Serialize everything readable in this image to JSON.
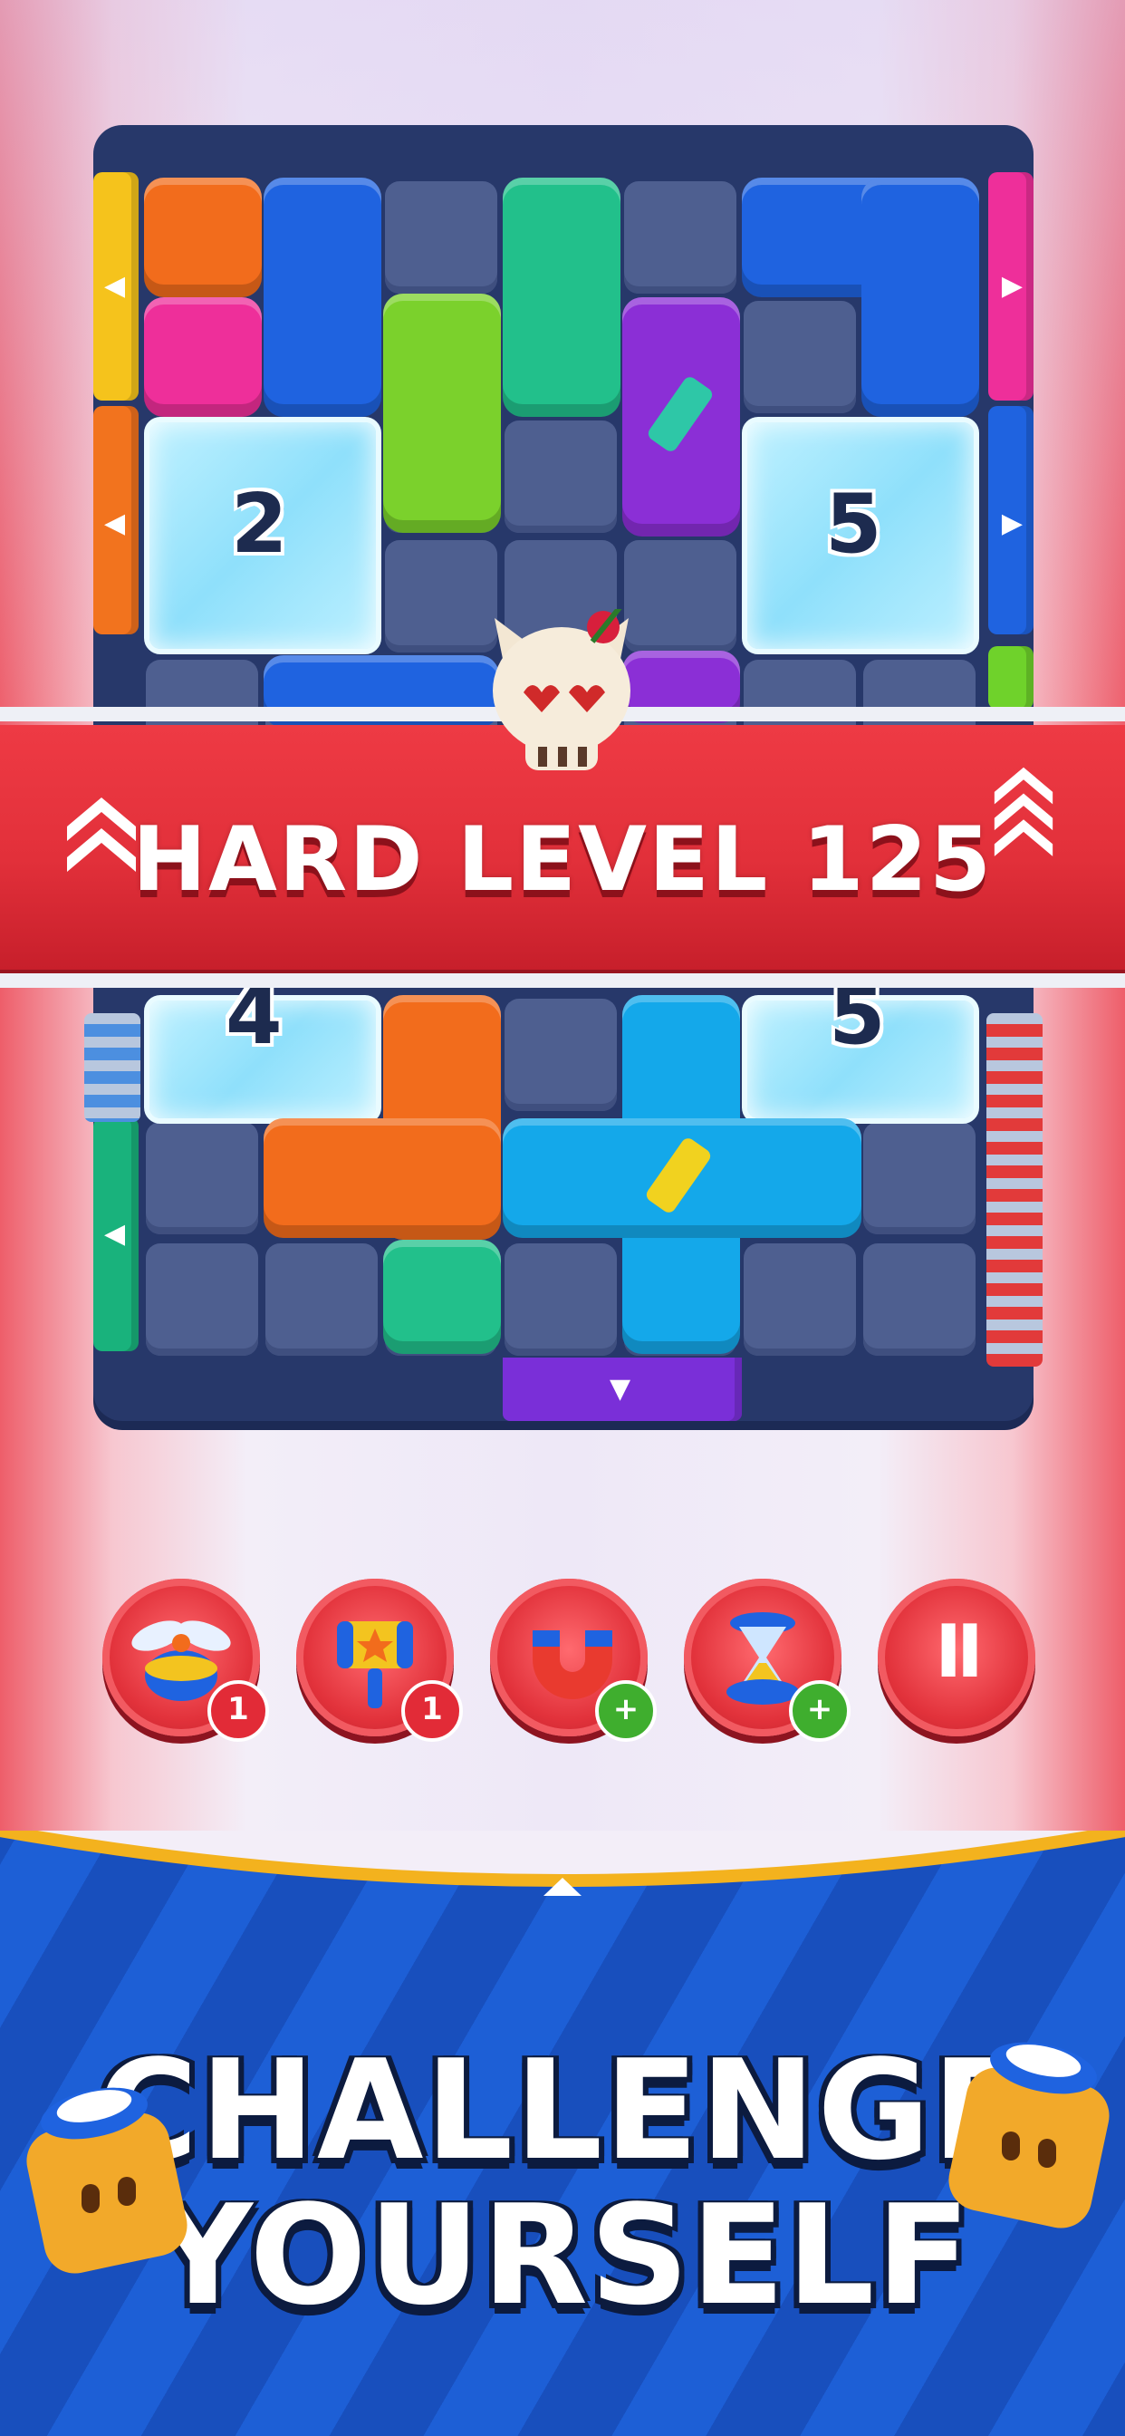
{
  "banner": {
    "title": "HARD LEVEL 125"
  },
  "board": {
    "ice_top_left": "2",
    "ice_top_right": "5",
    "ice_bottom_left": "4",
    "ice_bottom_right": "5"
  },
  "powerups": [
    {
      "name": "propeller",
      "count": "1",
      "badge_type": "count"
    },
    {
      "name": "hammer",
      "count": "1",
      "badge_type": "count"
    },
    {
      "name": "magnet",
      "count": "+",
      "badge_type": "add"
    },
    {
      "name": "hourglass",
      "count": "+",
      "badge_type": "add"
    }
  ],
  "pause_label": "II",
  "tagline": {
    "line1": "CHALLENGE",
    "line2": "YOURSELF"
  },
  "colors": {
    "banner_red": "#e2303a",
    "board_bg": "#27386a",
    "bottom_blue": "#1a55c7",
    "gold_rim": "#f3b21e"
  }
}
